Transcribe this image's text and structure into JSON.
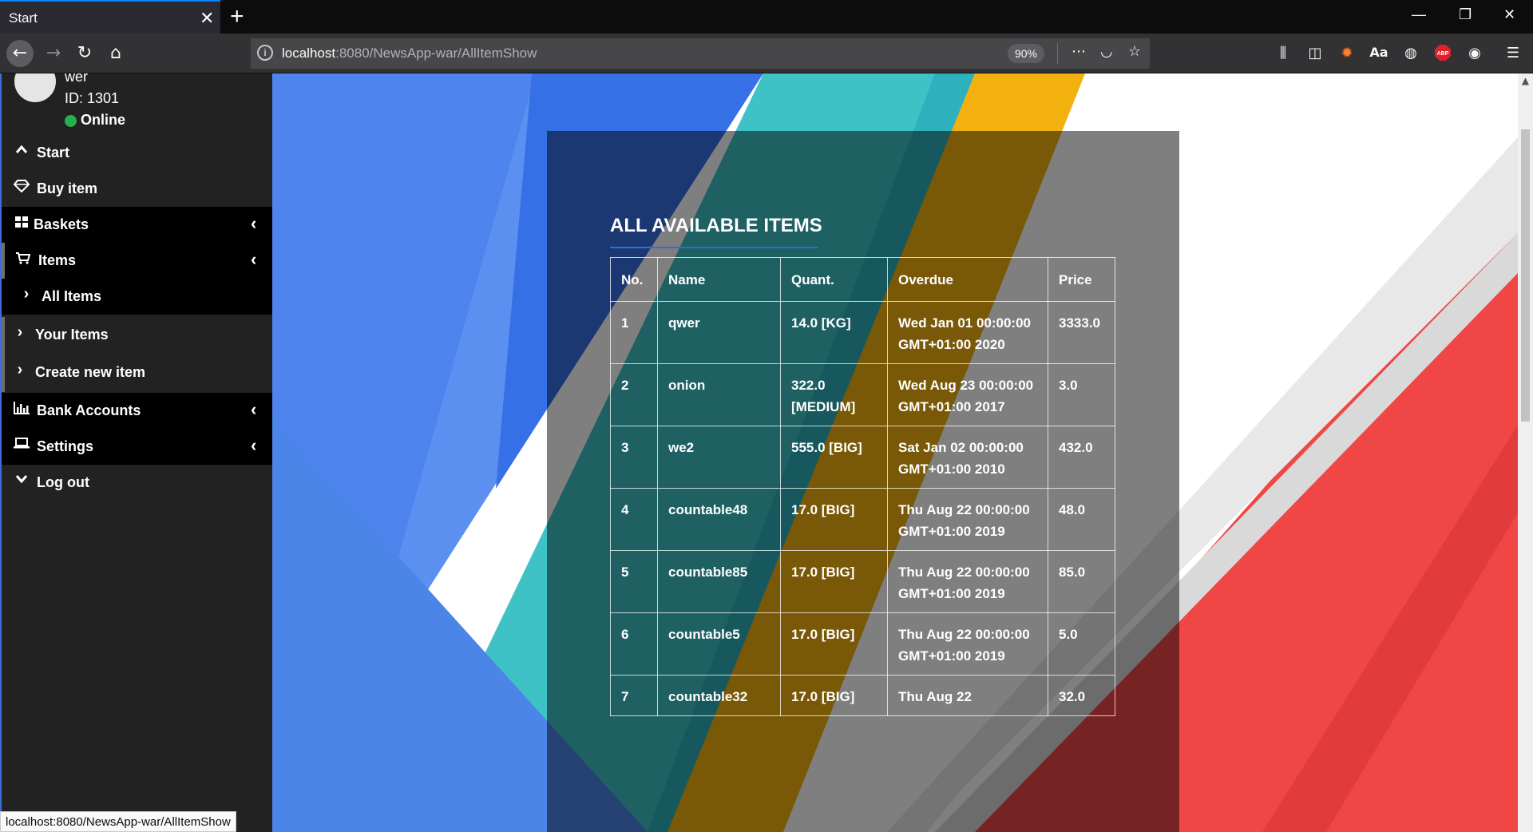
{
  "browser": {
    "tab_title": "Start",
    "tab_close": "✕",
    "new_tab": "+",
    "window_minimize": "—",
    "window_restore": "❐",
    "window_close": "✕",
    "url_host": "localhost",
    "url_path": ":8080/NewsApp-war/AllItemShow",
    "zoom": "90%",
    "status_url": "localhost:8080/NewsApp-war/AllItemShow"
  },
  "user": {
    "name": "wer",
    "id": "ID: 1301",
    "status": "Online"
  },
  "sidebar": {
    "items": [
      {
        "label": "Start",
        "icon": "chevron-up-icon",
        "glyph": "⌃",
        "arrow": ""
      },
      {
        "label": "Buy item",
        "icon": "diamond-icon",
        "glyph": "◇",
        "arrow": ""
      },
      {
        "label": "Baskets",
        "icon": "grid-icon",
        "glyph": "▦",
        "arrow": "‹"
      },
      {
        "label": "Items",
        "icon": "cart-icon",
        "glyph": "⛟",
        "arrow": "‹"
      },
      {
        "label": "All Items",
        "icon": "chevron-right-icon",
        "glyph": "›",
        "arrow": ""
      },
      {
        "label": "Your Items",
        "icon": "chevron-right-icon",
        "glyph": "›",
        "arrow": ""
      },
      {
        "label": "Create new item",
        "icon": "chevron-right-icon",
        "glyph": "›",
        "arrow": ""
      },
      {
        "label": "Bank Accounts",
        "icon": "bar-chart-icon",
        "glyph": "▥",
        "arrow": "‹"
      },
      {
        "label": "Settings",
        "icon": "laptop-icon",
        "glyph": "▭",
        "arrow": "‹"
      },
      {
        "label": "Log out",
        "icon": "chevron-down-icon",
        "glyph": "⌄",
        "arrow": ""
      }
    ]
  },
  "main": {
    "title": "ALL AVAILABLE ITEMS",
    "columns": [
      "No.",
      "Name",
      "Quant.",
      "Overdue",
      "Price"
    ],
    "rows": [
      {
        "no": "1",
        "name": "qwer",
        "quant": "14.0 [KG]",
        "overdue": "Wed Jan 01 00:00:00 GMT+01:00 2020",
        "price": "3333.0"
      },
      {
        "no": "2",
        "name": "onion",
        "quant": "322.0 [MEDIUM]",
        "overdue": "Wed Aug 23 00:00:00 GMT+01:00 2017",
        "price": "3.0"
      },
      {
        "no": "3",
        "name": "we2",
        "quant": "555.0 [BIG]",
        "overdue": "Sat Jan 02 00:00:00 GMT+01:00 2010",
        "price": "432.0"
      },
      {
        "no": "4",
        "name": "countable48",
        "quant": "17.0 [BIG]",
        "overdue": "Thu Aug 22 00:00:00 GMT+01:00 2019",
        "price": "48.0"
      },
      {
        "no": "5",
        "name": "countable85",
        "quant": "17.0 [BIG]",
        "overdue": "Thu Aug 22 00:00:00 GMT+01:00 2019",
        "price": "85.0"
      },
      {
        "no": "6",
        "name": "countable5",
        "quant": "17.0 [BIG]",
        "overdue": "Thu Aug 22 00:00:00 GMT+01:00 2019",
        "price": "5.0"
      },
      {
        "no": "7",
        "name": "countable32",
        "quant": "17.0 [BIG]",
        "overdue": "Thu Aug 22",
        "price": "32.0"
      }
    ]
  },
  "colors": {
    "accent": "#2e6de0",
    "online": "#23b14d",
    "bg_blue": "#4f8cf0",
    "bg_teal": "#3fc3c6",
    "bg_yellow": "#f2b10e",
    "bg_red": "#f14646"
  }
}
